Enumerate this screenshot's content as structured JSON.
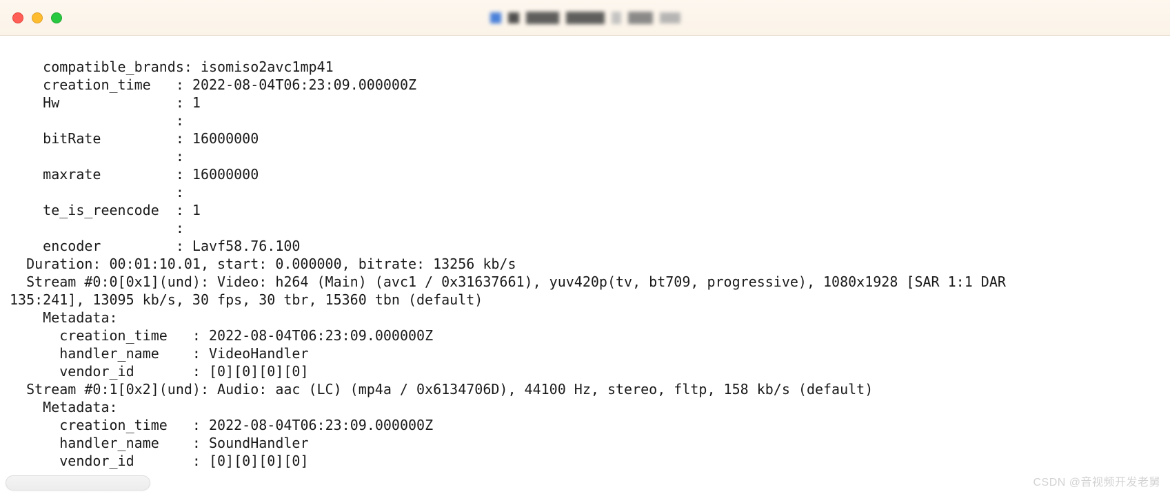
{
  "titlebar": {
    "traffic": {
      "red": "close",
      "yellow": "minimize",
      "green": "zoom"
    }
  },
  "metadata_top": {
    "compatible_brands": {
      "key": "compatible_brands",
      "value": "isomiso2avc1mp41"
    },
    "creation_time": {
      "key": "creation_time",
      "value": "2022-08-04T06:23:09.000000Z"
    },
    "hw": {
      "key": "Hw",
      "value": "1"
    },
    "blank1": {
      "key": "",
      "value": ""
    },
    "bitrate": {
      "key": "bitRate",
      "value": "16000000"
    },
    "blank2": {
      "key": "",
      "value": ""
    },
    "maxrate": {
      "key": "maxrate",
      "value": "16000000"
    },
    "blank3": {
      "key": "",
      "value": ""
    },
    "te_is_reencode": {
      "key": "te_is_reencode",
      "value": "1"
    },
    "blank4": {
      "key": "",
      "value": ""
    },
    "encoder": {
      "key": "encoder",
      "value": "Lavf58.76.100"
    }
  },
  "duration_line": "  Duration: 00:01:10.01, start: 0.000000, bitrate: 13256 kb/s",
  "stream0_line1": "  Stream #0:0[0x1](und): Video: h264 (Main) (avc1 / 0x31637661), yuv420p(tv, bt709, progressive), 1080x1928 [SAR 1:1 DAR ",
  "stream0_line2": "135:241], 13095 kb/s, 30 fps, 30 tbr, 15360 tbn (default)",
  "stream0_meta_header": "    Metadata:",
  "stream0_meta": {
    "creation_time": {
      "key": "creation_time",
      "value": "2022-08-04T06:23:09.000000Z"
    },
    "handler_name": {
      "key": "handler_name",
      "value": "VideoHandler"
    },
    "vendor_id": {
      "key": "vendor_id",
      "value": "[0][0][0][0]"
    }
  },
  "stream1_line": "  Stream #0:1[0x2](und): Audio: aac (LC) (mp4a / 0x6134706D), 44100 Hz, stereo, fltp, 158 kb/s (default)",
  "stream1_meta_header": "    Metadata:",
  "stream1_meta": {
    "creation_time": {
      "key": "creation_time",
      "value": "2022-08-04T06:23:09.000000Z"
    },
    "handler_name": {
      "key": "handler_name",
      "value": "SoundHandler"
    },
    "vendor_id": {
      "key": "vendor_id",
      "value": "[0][0][0][0]"
    }
  },
  "watermark": "CSDN @音视频开发老舅"
}
